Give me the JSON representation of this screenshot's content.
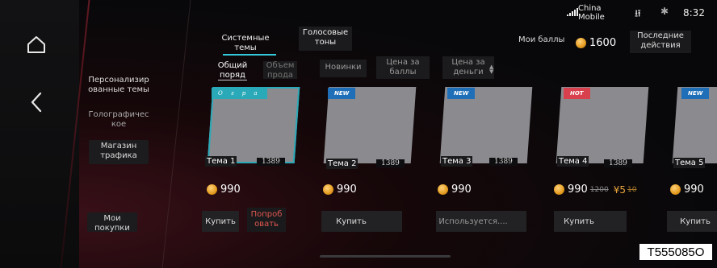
{
  "status": {
    "carrier": "China Mobile",
    "carrier_line1": "China",
    "carrier_line2": "Mobile",
    "time": "8:32",
    "icons": [
      "signal-icon",
      "usb-icon",
      "bluetooth-icon"
    ]
  },
  "nav": {
    "home_icon": "home-icon",
    "back_icon": "back-icon"
  },
  "sidebar": {
    "items": [
      {
        "label_lines": [
          "Персонализир",
          "ованные темы"
        ]
      },
      {
        "label_lines": [
          "Голографичес",
          "кое"
        ]
      },
      {
        "label_lines": [
          "Магазин",
          "трафика"
        ]
      }
    ],
    "my_purchases": [
      "Мои",
      "покупки"
    ]
  },
  "tabs": [
    {
      "label_lines": [
        "Системные",
        "темы"
      ],
      "active": true
    },
    {
      "label_lines": [
        "Голосовые",
        "тоны"
      ],
      "active": false
    }
  ],
  "header": {
    "points_label": "Мои баллы",
    "points_value": "1600",
    "recent_actions": [
      "Последние",
      "действия"
    ]
  },
  "filters": [
    {
      "label_lines": [
        "Общий",
        "поряд"
      ]
    },
    {
      "label_lines": [
        "Объем",
        "прода"
      ]
    },
    {
      "label_lines": [
        "Новинки"
      ]
    },
    {
      "label_lines": [
        "Цена за",
        "баллы"
      ]
    },
    {
      "label_lines": [
        "Цена за",
        "деньги"
      ]
    }
  ],
  "cards": [
    {
      "name": "Тема 1",
      "code": "1389",
      "badge": "О г р а",
      "badge_type": "cyan",
      "price": "990",
      "old_price": "",
      "rmb_price": "",
      "rmb_old": "",
      "action": "Купить",
      "try_lines": [
        "Попроб",
        "овать"
      ]
    },
    {
      "name": "Тема 2",
      "code": "1389",
      "badge": "NEW",
      "badge_type": "new",
      "price": "990",
      "old_price": "",
      "rmb_price": "",
      "rmb_old": "",
      "action": "Купить"
    },
    {
      "name": "Тема 3",
      "code": "1389",
      "badge": "NEW",
      "badge_type": "new",
      "price": "990",
      "old_price": "",
      "rmb_price": "",
      "rmb_old": "",
      "action": "Используется...."
    },
    {
      "name": "Тема 4",
      "code": "1389",
      "badge": "HOT",
      "badge_type": "hot",
      "price": "990",
      "old_price": "1200",
      "rmb_price": "¥5",
      "rmb_old": "10",
      "action": "Купить"
    },
    {
      "name": "Тема 5",
      "code": "",
      "badge": "NEW",
      "badge_type": "new",
      "price": "990",
      "old_price": "",
      "rmb_price": "",
      "rmb_old": "",
      "action": "Купить"
    }
  ],
  "watermark": "T555085O",
  "colors": {
    "accent": "#34c8d8",
    "new_badge": "#1f6fb8",
    "hot_badge": "#d8404e",
    "coin": "#e49b1f",
    "try_text": "#e0564f"
  }
}
